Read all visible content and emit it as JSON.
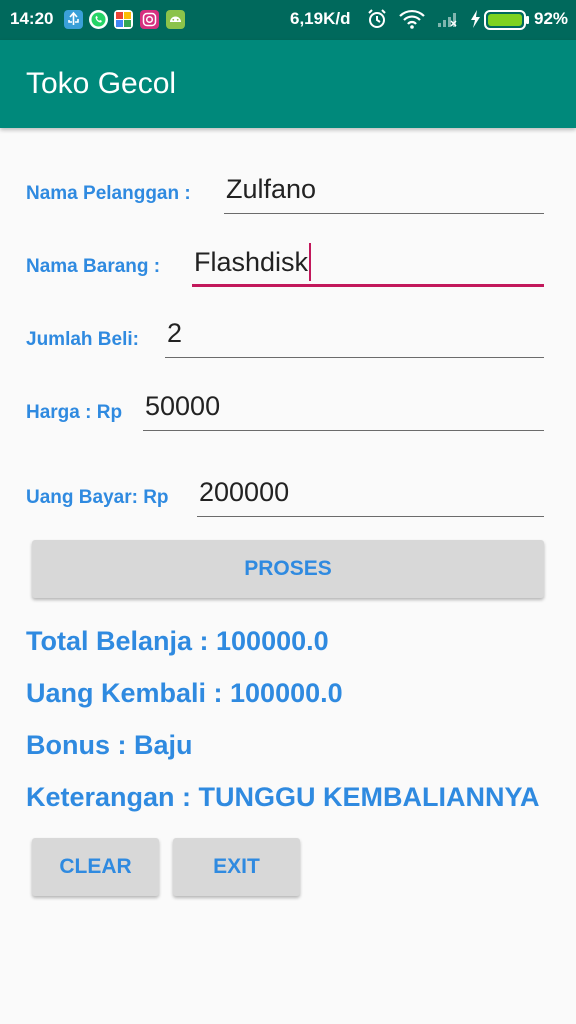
{
  "status_bar": {
    "time": "14:20",
    "network_speed": "6,19K/d",
    "battery": "92%",
    "notification_icons": [
      "usb-icon",
      "whatsapp-icon",
      "photos-icon",
      "instagram-icon",
      "android-icon"
    ],
    "colors": {
      "bar": "#00695c"
    }
  },
  "app_bar": {
    "title": "Toko Gecol",
    "color": "#00897b"
  },
  "form": {
    "nama_pelanggan": {
      "label": "Nama Pelanggan :",
      "value": "Zulfano"
    },
    "nama_barang": {
      "label": "Nama Barang :",
      "value": "Flashdisk"
    },
    "jumlah_beli": {
      "label": "Jumlah Beli:",
      "value": "2"
    },
    "harga": {
      "label": "Harga : Rp",
      "value": "50000"
    },
    "uang_bayar": {
      "label": "Uang Bayar: Rp",
      "value": "200000"
    }
  },
  "buttons": {
    "proses": "PROSES",
    "clear": "CLEAR",
    "exit": "EXIT"
  },
  "results": {
    "total_belanja": "Total Belanja : 100000.0",
    "uang_kembali": "Uang Kembali : 100000.0",
    "bonus": "Bonus : Baju",
    "keterangan": "Keterangan : TUNGGU KEMBALIANNYA"
  },
  "colors": {
    "accent": "#2f8ae0",
    "focus": "#c2185b",
    "button_bg": "#d8d8d8"
  }
}
